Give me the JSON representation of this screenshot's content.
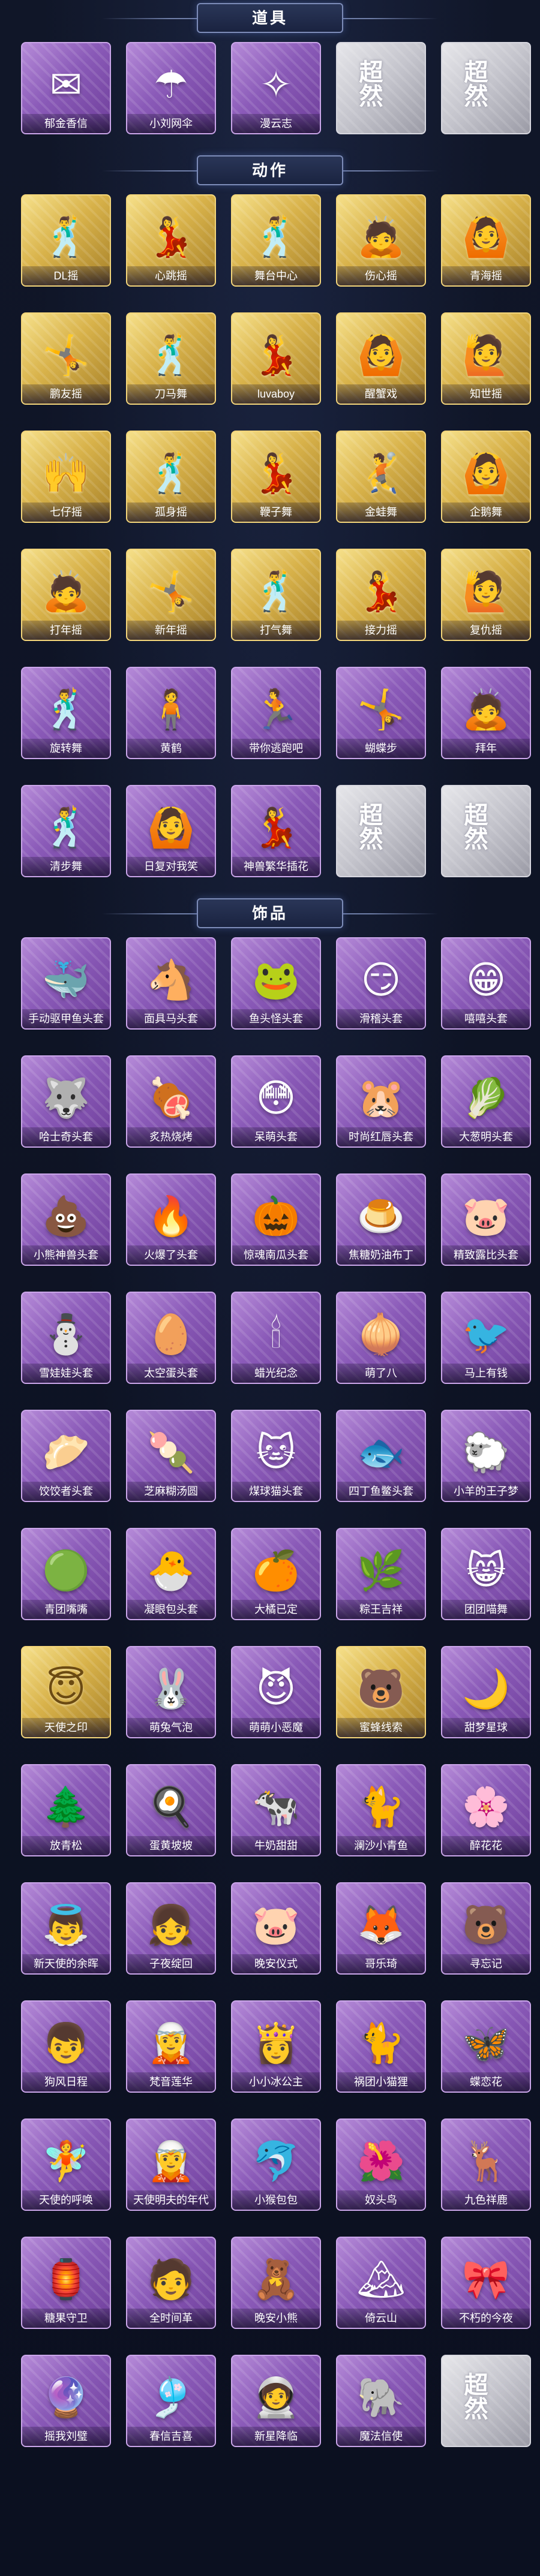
{
  "sections": [
    {
      "title": "道具",
      "items": [
        {
          "label": "郁金香信",
          "style": "purple",
          "icon": "✉",
          "icon_name": "tulip-letter-icon"
        },
        {
          "label": "小刘网伞",
          "style": "purple",
          "icon": "☂",
          "icon_name": "umbrella-icon"
        },
        {
          "label": "漫云志",
          "style": "purple",
          "icon": "✧",
          "icon_name": "sparkle-icon"
        },
        {
          "label": "",
          "style": "gray",
          "icon": "超然",
          "icon_name": "placeholder-logo-icon"
        },
        {
          "label": "",
          "style": "gray",
          "icon": "超然",
          "icon_name": "placeholder-logo-icon"
        }
      ]
    },
    {
      "title": "动作",
      "items": [
        {
          "label": "DL摇",
          "style": "gold",
          "icon": "🕺",
          "icon_name": "dance-pose-icon"
        },
        {
          "label": "心跳摇",
          "style": "gold",
          "icon": "💃",
          "icon_name": "dance-pose-icon"
        },
        {
          "label": "舞台中心",
          "style": "gold",
          "icon": "🕺",
          "icon_name": "dance-pose-icon"
        },
        {
          "label": "伤心摇",
          "style": "gold",
          "icon": "🙇",
          "icon_name": "dance-pose-icon"
        },
        {
          "label": "青海摇",
          "style": "gold",
          "icon": "🙆",
          "icon_name": "dance-pose-icon"
        },
        {
          "label": "鹏友摇",
          "style": "gold",
          "icon": "🤸",
          "icon_name": "dance-pose-icon"
        },
        {
          "label": "刀马舞",
          "style": "gold",
          "icon": "🕺",
          "icon_name": "dance-pose-icon"
        },
        {
          "label": "luvaboy",
          "style": "gold",
          "icon": "💃",
          "icon_name": "dance-pose-icon"
        },
        {
          "label": "醒蟹戏",
          "style": "gold",
          "icon": "🙆",
          "icon_name": "dance-pose-icon"
        },
        {
          "label": "知世摇",
          "style": "gold",
          "icon": "🙋",
          "icon_name": "dance-pose-icon"
        },
        {
          "label": "七仔摇",
          "style": "gold",
          "icon": "🙌",
          "icon_name": "dance-pose-icon"
        },
        {
          "label": "孤身摇",
          "style": "gold",
          "icon": "🕺",
          "icon_name": "dance-pose-icon"
        },
        {
          "label": "鞭子舞",
          "style": "gold",
          "icon": "💃",
          "icon_name": "dance-pose-icon"
        },
        {
          "label": "金蛙舞",
          "style": "gold",
          "icon": "🤾",
          "icon_name": "dance-pose-icon"
        },
        {
          "label": "企鹅舞",
          "style": "gold",
          "icon": "🙆",
          "icon_name": "dance-pose-icon"
        },
        {
          "label": "打年摇",
          "style": "gold",
          "icon": "🙇",
          "icon_name": "dance-pose-icon"
        },
        {
          "label": "新年摇",
          "style": "gold",
          "icon": "🤸",
          "icon_name": "dance-pose-icon"
        },
        {
          "label": "打气舞",
          "style": "gold",
          "icon": "🕺",
          "icon_name": "dance-pose-icon"
        },
        {
          "label": "接力摇",
          "style": "gold",
          "icon": "💃",
          "icon_name": "dance-pose-icon"
        },
        {
          "label": "复仇摇",
          "style": "gold",
          "icon": "🙋",
          "icon_name": "dance-pose-icon"
        },
        {
          "label": "旋转舞",
          "style": "purple",
          "icon": "🕺",
          "icon_name": "dance-pose-icon"
        },
        {
          "label": "黄鹤",
          "style": "purple",
          "icon": "🧍",
          "icon_name": "dance-pose-icon"
        },
        {
          "label": "带你逃跑吧",
          "style": "purple",
          "icon": "🏃",
          "icon_name": "dance-pose-icon"
        },
        {
          "label": "蝴蝶步",
          "style": "purple",
          "icon": "🤸",
          "icon_name": "dance-pose-icon"
        },
        {
          "label": "拜年",
          "style": "purple",
          "icon": "🙇",
          "icon_name": "dance-pose-icon"
        },
        {
          "label": "清步舞",
          "style": "purple",
          "icon": "🕺",
          "icon_name": "dance-pose-icon"
        },
        {
          "label": "日复对我笑",
          "style": "purple",
          "icon": "🙆",
          "icon_name": "dance-pose-icon"
        },
        {
          "label": "神兽繁华插花",
          "style": "purple",
          "icon": "💃",
          "icon_name": "dance-pose-icon"
        },
        {
          "label": "",
          "style": "gray",
          "icon": "超然",
          "icon_name": "placeholder-logo-icon"
        },
        {
          "label": "",
          "style": "gray",
          "icon": "超然",
          "icon_name": "placeholder-logo-icon"
        }
      ]
    },
    {
      "title": "饰品",
      "items": [
        {
          "label": "手动驱甲鱼头套",
          "style": "purple",
          "icon": "🐳",
          "icon_name": "whale-head-icon"
        },
        {
          "label": "面具马头套",
          "style": "purple",
          "icon": "🐴",
          "icon_name": "horse-head-icon"
        },
        {
          "label": "鱼头怪头套",
          "style": "purple",
          "icon": "🐸",
          "icon_name": "fish-monster-head-icon"
        },
        {
          "label": "滑稽头套",
          "style": "purple",
          "icon": "😏",
          "icon_name": "smirk-face-icon"
        },
        {
          "label": "嘻嘻头套",
          "style": "purple",
          "icon": "😁",
          "icon_name": "grin-face-icon"
        },
        {
          "label": "哈士奇头套",
          "style": "purple",
          "icon": "🐺",
          "icon_name": "husky-head-icon"
        },
        {
          "label": "炙热烧烤",
          "style": "purple",
          "icon": "🍖",
          "icon_name": "bbq-icon"
        },
        {
          "label": "呆萌头套",
          "style": "purple",
          "icon": "😳",
          "icon_name": "dazed-face-icon"
        },
        {
          "label": "时尚红唇头套",
          "style": "purple",
          "icon": "🐹",
          "icon_name": "pikachu-head-icon"
        },
        {
          "label": "大葱明头套",
          "style": "purple",
          "icon": "🥬",
          "icon_name": "leek-head-icon"
        },
        {
          "label": "小熊神兽头套",
          "style": "purple",
          "icon": "💩",
          "icon_name": "poop-head-icon"
        },
        {
          "label": "火爆了头套",
          "style": "purple",
          "icon": "🔥",
          "icon_name": "fire-head-icon"
        },
        {
          "label": "惊魂南瓜头套",
          "style": "purple",
          "icon": "🎃",
          "icon_name": "pumpkin-head-icon"
        },
        {
          "label": "焦糖奶油布丁",
          "style": "purple",
          "icon": "🍮",
          "icon_name": "pudding-icon"
        },
        {
          "label": "精致露比头套",
          "style": "purple",
          "icon": "🐷",
          "icon_name": "pink-bear-head-icon"
        },
        {
          "label": "雪娃娃头套",
          "style": "purple",
          "icon": "⛄",
          "icon_name": "snowman-head-icon"
        },
        {
          "label": "太空蛋头套",
          "style": "purple",
          "icon": "🥚",
          "icon_name": "egg-head-icon"
        },
        {
          "label": "蜡光纪念",
          "style": "purple",
          "icon": "🕯",
          "icon_name": "candle-icon"
        },
        {
          "label": "萌了八",
          "style": "purple",
          "icon": "🧅",
          "icon_name": "onion-icon"
        },
        {
          "label": "马上有钱",
          "style": "purple",
          "icon": "🐦",
          "icon_name": "bird-icon"
        },
        {
          "label": "饺饺者头套",
          "style": "purple",
          "icon": "🥟",
          "icon_name": "dumpling-head-icon"
        },
        {
          "label": "芝麻糊汤圆",
          "style": "purple",
          "icon": "🍡",
          "icon_name": "tangyuan-icon"
        },
        {
          "label": "煤球猫头套",
          "style": "purple",
          "icon": "🐱",
          "icon_name": "cat-head-icon"
        },
        {
          "label": "四丁鱼鳖头套",
          "style": "purple",
          "icon": "🐟",
          "icon_name": "fish-head-icon"
        },
        {
          "label": "小羊的王子梦",
          "style": "purple",
          "icon": "🐑",
          "icon_name": "sheep-head-icon"
        },
        {
          "label": "青团嘴嘴",
          "style": "purple",
          "icon": "🟢",
          "icon_name": "green-rice-ball-icon"
        },
        {
          "label": "凝眼包头套",
          "style": "purple",
          "icon": "🐣",
          "icon_name": "chick-head-icon"
        },
        {
          "label": "大橘已定",
          "style": "purple",
          "icon": "🍊",
          "icon_name": "orange-head-icon"
        },
        {
          "label": "粽王吉祥",
          "style": "purple",
          "icon": "🌿",
          "icon_name": "zongzi-icon"
        },
        {
          "label": "团团喵舞",
          "style": "purple",
          "icon": "😸",
          "icon_name": "cat-face-icon"
        },
        {
          "label": "天使之印",
          "style": "gold",
          "icon": "😇",
          "icon_name": "angel-icon"
        },
        {
          "label": "萌兔气泡",
          "style": "purple",
          "icon": "🐰",
          "icon_name": "bunny-bubble-icon"
        },
        {
          "label": "萌萌小恶魔",
          "style": "purple",
          "icon": "😈",
          "icon_name": "devil-icon"
        },
        {
          "label": "蜜蜂线索",
          "style": "gold",
          "icon": "🐻",
          "icon_name": "bear-icon"
        },
        {
          "label": "甜梦星球",
          "style": "purple",
          "icon": "🌙",
          "icon_name": "moon-icon"
        },
        {
          "label": "放青松",
          "style": "purple",
          "icon": "🌲",
          "icon_name": "pine-tree-icon"
        },
        {
          "label": "蛋黄坡坡",
          "style": "purple",
          "icon": "🍳",
          "icon_name": "egg-yolk-icon"
        },
        {
          "label": "牛奶甜甜",
          "style": "purple",
          "icon": "🐄",
          "icon_name": "cow-icon"
        },
        {
          "label": "澜沙小青鱼",
          "style": "purple",
          "icon": "🐈",
          "icon_name": "blue-cat-icon"
        },
        {
          "label": "醉花花",
          "style": "purple",
          "icon": "🌸",
          "icon_name": "flower-icon"
        },
        {
          "label": "新天使的余晖",
          "style": "purple",
          "icon": "👼",
          "icon_name": "angel-girl-icon"
        },
        {
          "label": "子夜绽回",
          "style": "purple",
          "icon": "👧",
          "icon_name": "girl-icon"
        },
        {
          "label": "晚安仪式",
          "style": "purple",
          "icon": "🐷",
          "icon_name": "pig-icon"
        },
        {
          "label": "哥乐琦",
          "style": "purple",
          "icon": "🦊",
          "icon_name": "fox-icon"
        },
        {
          "label": "寻忘记",
          "style": "purple",
          "icon": "🐻",
          "icon_name": "bear-icon"
        },
        {
          "label": "狗风日程",
          "style": "purple",
          "icon": "👦",
          "icon_name": "boy-icon"
        },
        {
          "label": "梵音莲华",
          "style": "purple",
          "icon": "🧝",
          "icon_name": "elf-icon"
        },
        {
          "label": "小小冰公主",
          "style": "purple",
          "icon": "👸",
          "icon_name": "princess-icon"
        },
        {
          "label": "祸团小猫狸",
          "style": "purple",
          "icon": "🐈",
          "icon_name": "cat-icon"
        },
        {
          "label": "蝶恋花",
          "style": "purple",
          "icon": "🦋",
          "icon_name": "butterfly-icon"
        },
        {
          "label": "天使的呼唤",
          "style": "purple",
          "icon": "🧚",
          "icon_name": "fairy-icon"
        },
        {
          "label": "天使明夫的年代",
          "style": "purple",
          "icon": "🧝",
          "icon_name": "elf-icon"
        },
        {
          "label": "小猴包包",
          "style": "purple",
          "icon": "🐬",
          "icon_name": "dolphin-icon"
        },
        {
          "label": "奴头鸟",
          "style": "purple",
          "icon": "🌺",
          "icon_name": "flower-girl-icon"
        },
        {
          "label": "九色祥鹿",
          "style": "purple",
          "icon": "🦌",
          "icon_name": "deer-icon"
        },
        {
          "label": "糖果守卫",
          "style": "purple",
          "icon": "🏮",
          "icon_name": "lantern-icon"
        },
        {
          "label": "全时间革",
          "style": "purple",
          "icon": "🧑",
          "icon_name": "boy-icon"
        },
        {
          "label": "晚安小熊",
          "style": "purple",
          "icon": "🧸",
          "icon_name": "teddy-bear-icon"
        },
        {
          "label": "倚云山",
          "style": "purple",
          "icon": "🏔",
          "icon_name": "mountain-icon"
        },
        {
          "label": "不朽的今夜",
          "style": "purple",
          "icon": "🎀",
          "icon_name": "ribbon-icon"
        },
        {
          "label": "摇我刘璧",
          "style": "purple",
          "icon": "🔮",
          "icon_name": "orb-icon"
        },
        {
          "label": "春信吉喜",
          "style": "purple",
          "icon": "🎐",
          "icon_name": "chime-icon"
        },
        {
          "label": "新星降临",
          "style": "purple",
          "icon": "🧑‍🚀",
          "icon_name": "astronaut-icon"
        },
        {
          "label": "魔法信使",
          "style": "purple",
          "icon": "🐘",
          "icon_name": "elephant-icon"
        },
        {
          "label": "",
          "style": "gray",
          "icon": "超然",
          "icon_name": "placeholder-logo-icon"
        }
      ]
    }
  ]
}
